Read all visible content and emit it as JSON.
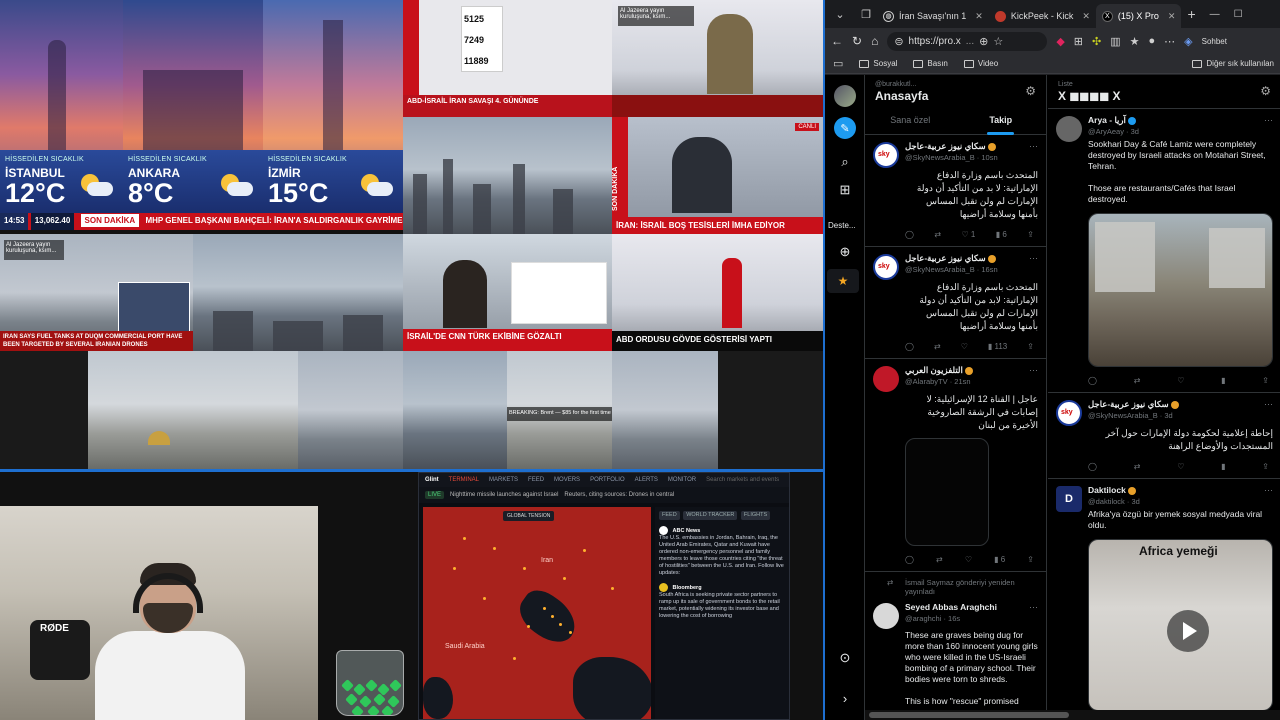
{
  "stream": {
    "weather": [
      {
        "label": "HİSSEDİLEN SICAKLIK",
        "city": "İSTANBUL",
        "temp": "12°C"
      },
      {
        "label": "HİSSEDİLEN SICAKLIK",
        "city": "ANKARA",
        "temp": "8°C"
      },
      {
        "label": "HİSSEDİLEN SICAKLIK",
        "city": "İZMİR",
        "temp": "15°C"
      }
    ],
    "ticker_time": "14:53",
    "ticker_index": "13,062.40",
    "ticker_badge": "SON DAKİKA",
    "ticker_text": "MHP GENEL BAŞKANI BAHÇELİ: İRAN'A SALDIRGANLIK GAYRİMEŞRU",
    "market_values": [
      "5125",
      "7249",
      "11889"
    ],
    "war_day": "ABD-İSRAİL İRAN SAVAŞI 4. GÜNÜNDE",
    "cnn_headline": "İRAN: İSRAİL BOŞ TESİSLERİ İMHA EDİYOR",
    "son_dakika": "SON DAKİKA",
    "canli": "CANLI",
    "cnn_turk": "İSRAİL'DE CNN TÜRK EKİBİNE GÖZALTI",
    "abd_ordusu": "ABD ORDUSU GÖVDE GÖSTERİSİ YAPTI",
    "aljazeera": "Al Jazeera yayın kuruluşuna, ksım...",
    "iran_says": "IRAN SAYS FUEL TANKS AT DUQM COMMERCIAL PORT HAVE BEEN TARGETED BY SEVERAL IRANIAN DRONES",
    "breaking": "BREAKING: Brent — $85 for the first time since mid-",
    "mic_brand": "RØDE"
  },
  "glint": {
    "brand": "Glint",
    "nav": [
      "TERMINAL",
      "MARKETS",
      "FEED",
      "MOVERS",
      "PORTFOLIO",
      "ALERTS",
      "MONITOR"
    ],
    "search_placeholder": "Search markets and events",
    "live": "LIVE",
    "headline1": "Nighttime missile launches against Israel",
    "headline2": "Reuters, citing sources: Drones in central",
    "map_header": "GLOBAL TENSION",
    "map_labels": [
      "Iran",
      "Saudi Arabia"
    ],
    "feed_tabs": [
      "FEED",
      "WORLD TRACKER",
      "FLIGHTS"
    ],
    "feed_items": [
      {
        "source": "ABC News",
        "body": "The U.S. embassies in Jordan, Bahrain, Iraq, the United Arab Emirates, Qatar and Kuwait have ordered non-emergency personnel and family members to leave those countries citing \"the threat of hostilities\" between the U.S. and Iran. Follow live updates:"
      },
      {
        "source": "Bloomberg",
        "body": "South Africa is seeking private sector partners to ramp up its sale of government bonds to the retail market, potentially widening its investor base and lowering the cost of borrowing"
      }
    ]
  },
  "browser": {
    "tabs": [
      {
        "label": "İran Savaşı'nın 1",
        "active": false
      },
      {
        "label": "KickPeek - Kick",
        "active": false
      },
      {
        "label": "(15) X Pro",
        "active": true
      }
    ],
    "url_host": "https://pro.x",
    "url_rest": "...",
    "bookmarks": [
      "Sosyal",
      "Basın",
      "Video"
    ],
    "bookmarks_other": "Diğer sık kullanılan",
    "sohbet": "Sohbet"
  },
  "x": {
    "rail_label": "Deste...",
    "col1": {
      "user": "@burakkutl...",
      "title": "Anasayfa",
      "tabs": [
        "Sana özel",
        "Takip"
      ],
      "tweets": [
        {
          "name": "سكاي نيوز عربية-عاجل",
          "handle": "@SkyNewsArabia_B · 10sn",
          "body": "المتحدث باسم وزارة الدفاع الإماراتية: لا بد من التأكيد أن دولة الإمارات لم ولن تقبل المساس بأمنها وسلامة أراضيها",
          "replies": "",
          "retweets": "",
          "likes": "1",
          "views": "6"
        },
        {
          "name": "سكاي نيوز عربية-عاجل",
          "handle": "@SkyNewsArabia_B · 16sn",
          "body": "المتحدث باسم وزارة الدفاع الإماراتية: لابد من التأكيد أن دولة الإمارات لم ولن تقبل المساس بأمنها وسلامة أراضيها",
          "replies": "",
          "retweets": "",
          "likes": "",
          "views": "113"
        },
        {
          "name": "التلفزيون العربي",
          "handle": "@AlarabyTV · 21sn",
          "body": "عاجل | القناة 12 الإسرائيلية: لا إصابات في الرشقة الصاروخية الأخيرة من لبنان",
          "replies": "",
          "retweets": "",
          "likes": "",
          "views": "6"
        },
        {
          "retweeted_by": "İsmail Saymaz gönderiyi yeniden yayınladı",
          "name": "Seyed Abbas Araghchi",
          "handle": "@araghchi · 16s",
          "body": "These are graves being dug for more than 160 innocent young girls who were killed in the US-Israeli bombing of a primary school. Their bodies were torn to shreds.\n\nThis is how \"rescue\" promised"
        }
      ]
    },
    "col2": {
      "user": "Liste",
      "title": "X ◼◼◼◼ X",
      "tweets": [
        {
          "name": "Arya - آریا",
          "handle": "@AryAeay · 3d",
          "body": "Sookhari Day & Café Lamiz were completely destroyed by Israeli attacks on Motahari Street, Tehran.\n\nThose are restaurants/Cafés that Israel destroyed."
        },
        {
          "name": "سكاي نيوز عربية-عاجل",
          "handle": "@SkyNewsArabia_B · 3d",
          "body": "إحاطة إعلامية لحكومة دولة الإمارات حول آخر المستجدات والأوضاع الراهنة"
        },
        {
          "name": "Daktilock",
          "handle": "@daktilock · 3d",
          "body": "Afrika'ya özgü bir yemek sosyal medyada viral oldu.",
          "video_caption": "Africa yemeği"
        }
      ]
    }
  },
  "colors": {
    "accent": "#1d9bf0",
    "breaking_red": "#c8101a",
    "glint_red": "#a8221c"
  }
}
